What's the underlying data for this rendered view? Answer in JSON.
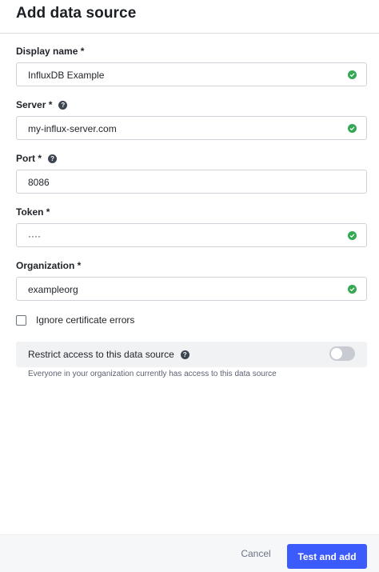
{
  "dialog": {
    "title": "Add data source"
  },
  "fields": {
    "display_name": {
      "label": "Display name *",
      "value": "InfluxDB Example"
    },
    "server": {
      "label": "Server *",
      "value": "my-influx-server.com"
    },
    "port": {
      "label": "Port *",
      "value": "8086"
    },
    "token": {
      "label": "Token *",
      "value": "····"
    },
    "organization": {
      "label": "Organization *",
      "value": "exampleorg"
    }
  },
  "ignore_cert": {
    "label": "Ignore certificate errors"
  },
  "restrict": {
    "label": "Restrict access to this data source",
    "note": "Everyone in your organization currently has access to this data source"
  },
  "footer": {
    "cancel_label": "Cancel",
    "submit_label": "Test and add"
  },
  "icons": {
    "valid": "check-circle-icon",
    "help": "question-circle-icon"
  },
  "colors": {
    "primary": "#3b5bfd",
    "valid": "#34a853"
  }
}
